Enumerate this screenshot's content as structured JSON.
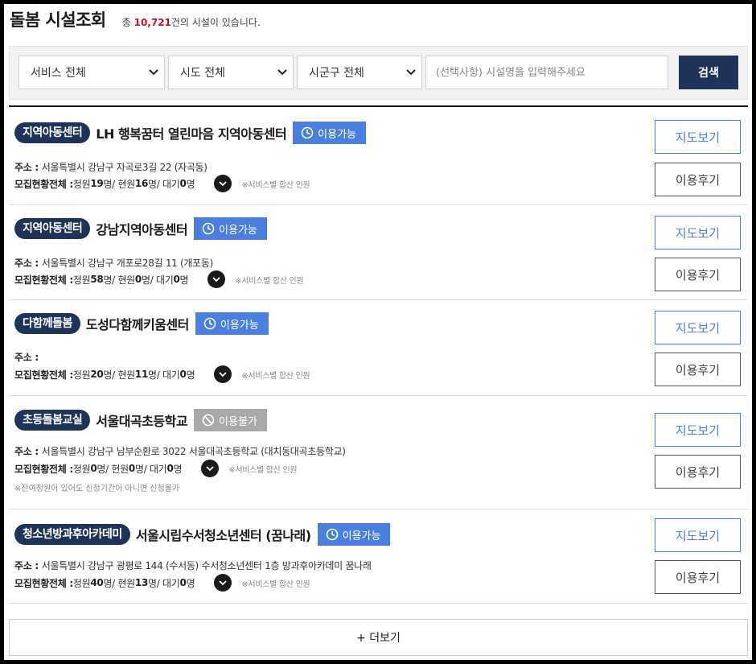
{
  "header": {
    "title": "돌봄 시설조회",
    "count_prefix": "총 ",
    "count_value": "10,721",
    "count_suffix": "건의 시설이 있습니다."
  },
  "search": {
    "service_select": "서비스 전체",
    "sido_select": "시도 전체",
    "sigungu_select": "시군구 전체",
    "placeholder": "(선택사항) 시설명을 입력해주세요",
    "button": "검색"
  },
  "labels": {
    "address": "주소 : ",
    "recruit": "모집현황전체 : ",
    "capacity": "정원 ",
    "current": " / 현원 ",
    "waiting": " / 대기 ",
    "unit": "명",
    "service_note": "※서비스별 합산 인원",
    "map_button": "지도보기",
    "review_button": "이용후기"
  },
  "facilities": [
    {
      "category": "지역아동센터",
      "name": "LH 행복꿈터 열린마음 지역아동센터",
      "status": "이용가능",
      "address": "서울특별시 강남구 자곡로3길 22 (자곡동)",
      "capacity": "19",
      "current": "16",
      "waiting": "0",
      "warning": ""
    },
    {
      "category": "지역아동센터",
      "name": "강남지역아동센터",
      "status": "이용가능",
      "address": "서울특별시 강남구 개포로28길 11 (개포동)",
      "capacity": "58",
      "current": "0",
      "waiting": "0",
      "warning": ""
    },
    {
      "category": "다함께돌봄",
      "name": "도성다함께키움센터",
      "status": "이용가능",
      "address": "",
      "capacity": "20",
      "current": "11",
      "waiting": "0",
      "warning": ""
    },
    {
      "category": "초등돌봄교실",
      "name": "서울대곡초등학교",
      "status": "이용불가",
      "address": "서울특별시 강남구 남부순환로 3022 서울대곡초등학교 (대치동대곡초등학교)",
      "capacity": "0",
      "current": "0",
      "waiting": "0",
      "warning": "※잔여정원이 있어도 신청기간이 아니면 신청불가"
    },
    {
      "category": "청소년방과후아카데미",
      "name": "서울시립수서청소년센터 (꿈나래)",
      "status": "이용가능",
      "address": "서울특별시 강남구 광평로 144 (수서동) 수서청소년센터 1층 방과후아카데미 꿈나래",
      "capacity": "40",
      "current": "13",
      "waiting": "0",
      "warning": ""
    }
  ],
  "more_button": "+ 더보기",
  "colors": {
    "navy": "#1f3358",
    "available": "#4a7fe0",
    "unavailable": "#a9a9a9",
    "count_red": "#c8102e"
  }
}
